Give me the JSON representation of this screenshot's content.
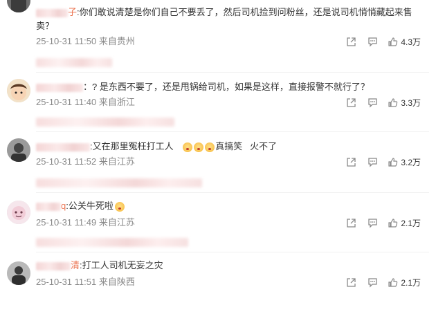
{
  "comments": [
    {
      "name_tail": "子",
      "text": ":你们敢说清楚是你们自己不要丢了，然后司机捡到问粉丝，还是说司机悄悄藏起来售卖？",
      "emoji_after": "",
      "time": "25-10-31 11:50 来自贵州",
      "likes": "4.3万"
    },
    {
      "name_tail": "",
      "text": "：? 是东西不要了，还是甩锅给司机，如果是这样，直接报警不就行了？",
      "emoji_after": "",
      "time": "25-10-31 11:40 来自浙江",
      "likes": "3.3万"
    },
    {
      "name_tail": "",
      "text": ":又在那里冤枉打工人",
      "emoji_after": "真搞笑   火不了",
      "time": "25-10-31 11:52 来自江苏",
      "likes": "3.2万"
    },
    {
      "name_tail": "q",
      "text": ":公关牛死啦",
      "emoji_after": "",
      "time": "25-10-31 11:49 来自江苏",
      "likes": "2.1万"
    },
    {
      "name_tail": "清",
      "text": ":打工人司机无妄之灾",
      "emoji_after": "",
      "time": "25-10-31 11:51 来自陕西",
      "likes": "2.1万"
    }
  ],
  "icons": {
    "share": "share-icon",
    "reply": "comment-icon",
    "like": "thumbs-up-icon"
  },
  "colors": {
    "name_tail": "#eb7350",
    "meta": "#888888"
  }
}
